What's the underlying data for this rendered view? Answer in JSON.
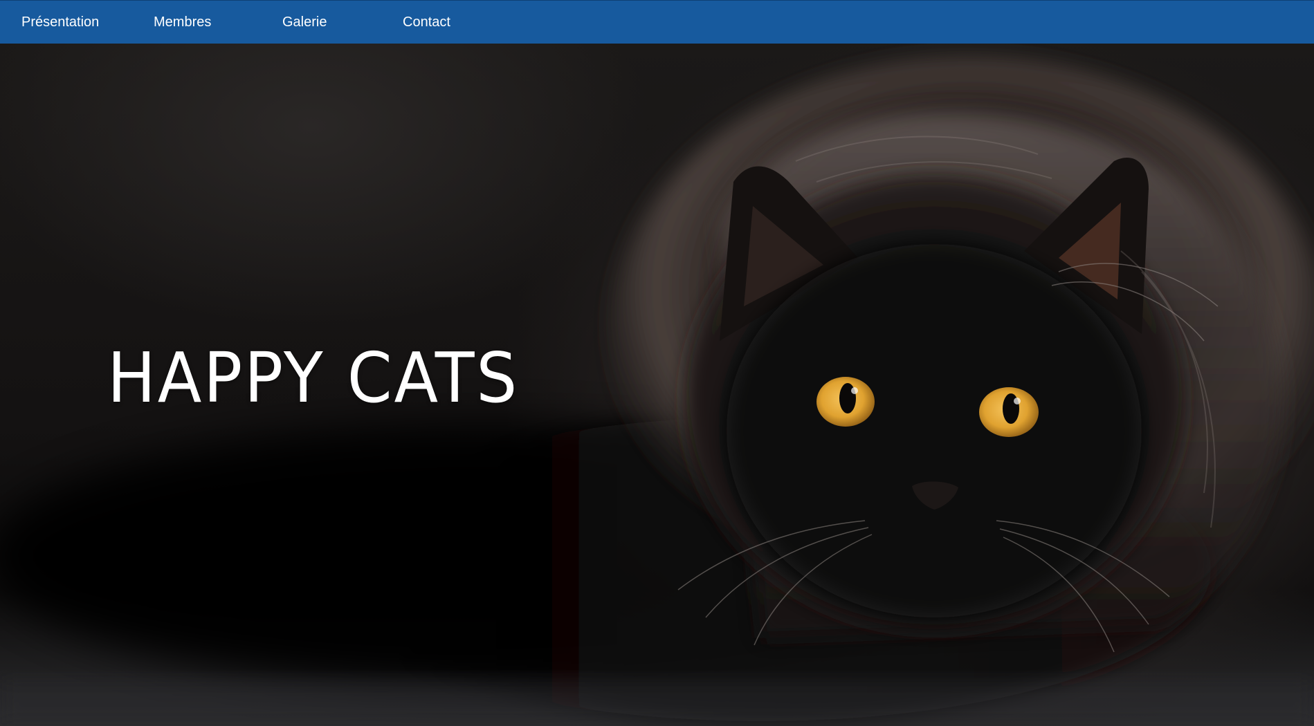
{
  "nav": {
    "items": [
      {
        "label": "Présentation"
      },
      {
        "label": "Membres"
      },
      {
        "label": "Galerie"
      },
      {
        "label": "Contact"
      }
    ]
  },
  "hero": {
    "title": "HAPPY CATS",
    "image": "black-cat-photo"
  },
  "colors": {
    "nav_background": "#175a9e",
    "nav_text": "#ffffff",
    "hero_title": "#ffffff",
    "cat_eye": "#e0a230"
  }
}
